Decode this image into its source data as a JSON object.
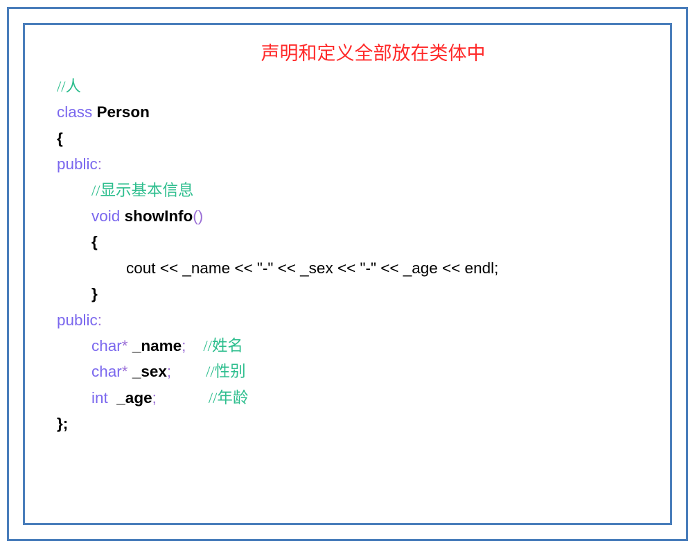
{
  "frame": {
    "border_color": "#4a7ebb",
    "background": "#ffffff"
  },
  "title": {
    "text": "声明和定义全部放在类体中",
    "color": "#ff2a2a"
  },
  "palette": {
    "keyword": "#7b68ee",
    "comment": "#2ebe8e",
    "punctuation": "#9b6fd6",
    "identifier": "#000000",
    "plain": "#000000"
  },
  "code": {
    "language": "cpp",
    "lines": [
      {
        "indent": 0,
        "tokens": [
          {
            "t": "comment",
            "s": "//人"
          }
        ]
      },
      {
        "indent": 0,
        "tokens": [
          {
            "t": "kw",
            "s": "class"
          },
          {
            "t": "plain",
            "s": " "
          },
          {
            "t": "id",
            "s": "Person"
          }
        ]
      },
      {
        "indent": 0,
        "tokens": [
          {
            "t": "brace",
            "s": "{"
          }
        ]
      },
      {
        "indent": 0,
        "tokens": [
          {
            "t": "kw",
            "s": "public"
          },
          {
            "t": "punct",
            "s": ":"
          }
        ]
      },
      {
        "indent": 1,
        "tokens": [
          {
            "t": "comment",
            "s": "//显示基本信息"
          }
        ]
      },
      {
        "indent": 1,
        "tokens": [
          {
            "t": "kw",
            "s": "void"
          },
          {
            "t": "plain",
            "s": " "
          },
          {
            "t": "id",
            "s": "showInfo"
          },
          {
            "t": "punct",
            "s": "()"
          }
        ]
      },
      {
        "indent": 1,
        "tokens": [
          {
            "t": "brace",
            "s": "{"
          }
        ]
      },
      {
        "indent": 2,
        "tokens": [
          {
            "t": "plain",
            "s": "cout << _name << \"-\" << _sex << \"-\" << _age << endl;"
          }
        ]
      },
      {
        "indent": 1,
        "tokens": [
          {
            "t": "brace",
            "s": "}"
          }
        ]
      },
      {
        "indent": 0,
        "tokens": [
          {
            "t": "kw",
            "s": "public"
          },
          {
            "t": "punct",
            "s": ":"
          }
        ]
      },
      {
        "indent": 1,
        "tokens": [
          {
            "t": "kw",
            "s": "char"
          },
          {
            "t": "punct",
            "s": "*"
          },
          {
            "t": "plain",
            "s": " "
          },
          {
            "t": "id",
            "s": "_name"
          },
          {
            "t": "punct",
            "s": ";"
          },
          {
            "t": "plain",
            "s": "    "
          },
          {
            "t": "comment",
            "s": "//姓名"
          }
        ]
      },
      {
        "indent": 1,
        "tokens": [
          {
            "t": "kw",
            "s": "char"
          },
          {
            "t": "punct",
            "s": "*"
          },
          {
            "t": "plain",
            "s": " "
          },
          {
            "t": "id",
            "s": "_sex"
          },
          {
            "t": "punct",
            "s": ";"
          },
          {
            "t": "plain",
            "s": "        "
          },
          {
            "t": "comment",
            "s": "//性别"
          }
        ]
      },
      {
        "indent": 1,
        "tokens": [
          {
            "t": "kw",
            "s": "int"
          },
          {
            "t": "plain",
            "s": "  "
          },
          {
            "t": "id",
            "s": "_age"
          },
          {
            "t": "punct",
            "s": ";"
          },
          {
            "t": "plain",
            "s": "            "
          },
          {
            "t": "comment",
            "s": "//年龄"
          }
        ]
      },
      {
        "indent": 0,
        "tokens": [
          {
            "t": "brace",
            "s": "};"
          }
        ]
      }
    ]
  }
}
